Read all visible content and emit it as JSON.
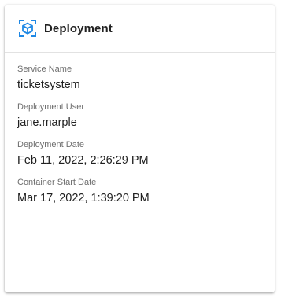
{
  "header": {
    "title": "Deployment",
    "icon": "deployment-cube-icon",
    "accent_color": "#1e88e5"
  },
  "fields": [
    {
      "label": "Service Name",
      "value": "ticketsystem"
    },
    {
      "label": "Deployment User",
      "value": "jane.marple"
    },
    {
      "label": "Deployment Date",
      "value": "Feb 11, 2022, 2:26:29 PM"
    },
    {
      "label": "Container Start Date",
      "value": "Mar 17, 2022, 1:39:20 PM"
    }
  ]
}
